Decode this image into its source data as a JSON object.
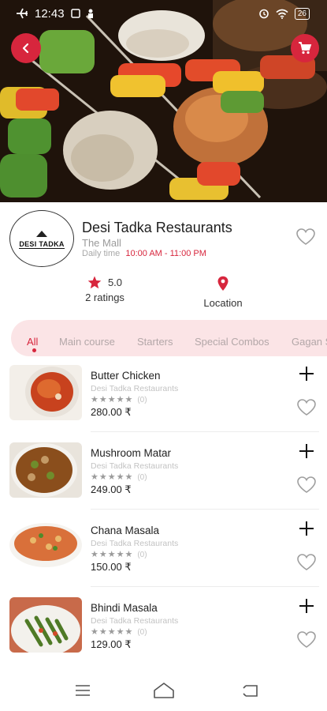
{
  "status_bar": {
    "time": "12:43",
    "battery": "26"
  },
  "restaurant": {
    "name": "Desi Tadka Restaurants",
    "location": "The Mall",
    "time_label": "Daily time",
    "time_value": "10:00 AM - 11:00 PM",
    "logo_text": "DESI TADKA",
    "rating": "5.0",
    "ratings_count": "2 ratings",
    "location_label": "Location"
  },
  "categories": [
    {
      "label": "All",
      "active": true
    },
    {
      "label": "Main course",
      "active": false
    },
    {
      "label": "Starters",
      "active": false
    },
    {
      "label": "Special Combos",
      "active": false
    },
    {
      "label": "Gagan Sp",
      "active": false
    }
  ],
  "items": [
    {
      "name": "Butter Chicken",
      "restaurant": "Desi Tadka Restaurants",
      "rating_count": "(0)",
      "price": "280.00 ₹"
    },
    {
      "name": "Mushroom Matar",
      "restaurant": "Desi Tadka Restaurants",
      "rating_count": "(0)",
      "price": "249.00 ₹"
    },
    {
      "name": "Chana Masala",
      "restaurant": "Desi Tadka Restaurants",
      "rating_count": "(0)",
      "price": "150.00 ₹"
    },
    {
      "name": "Bhindi Masala",
      "restaurant": "Desi Tadka Restaurants",
      "rating_count": "(0)",
      "price": "129.00 ₹"
    }
  ],
  "colors": {
    "accent": "#d7263d",
    "category_bg": "#fbe4e6"
  },
  "icons": [
    "airplane-icon",
    "wifi-icon",
    "alarm-icon",
    "back-arrow-icon",
    "cart-icon",
    "heart-outline-icon",
    "star-icon",
    "location-pin-icon",
    "plus-icon",
    "menu-icon",
    "home-icon",
    "return-icon"
  ]
}
